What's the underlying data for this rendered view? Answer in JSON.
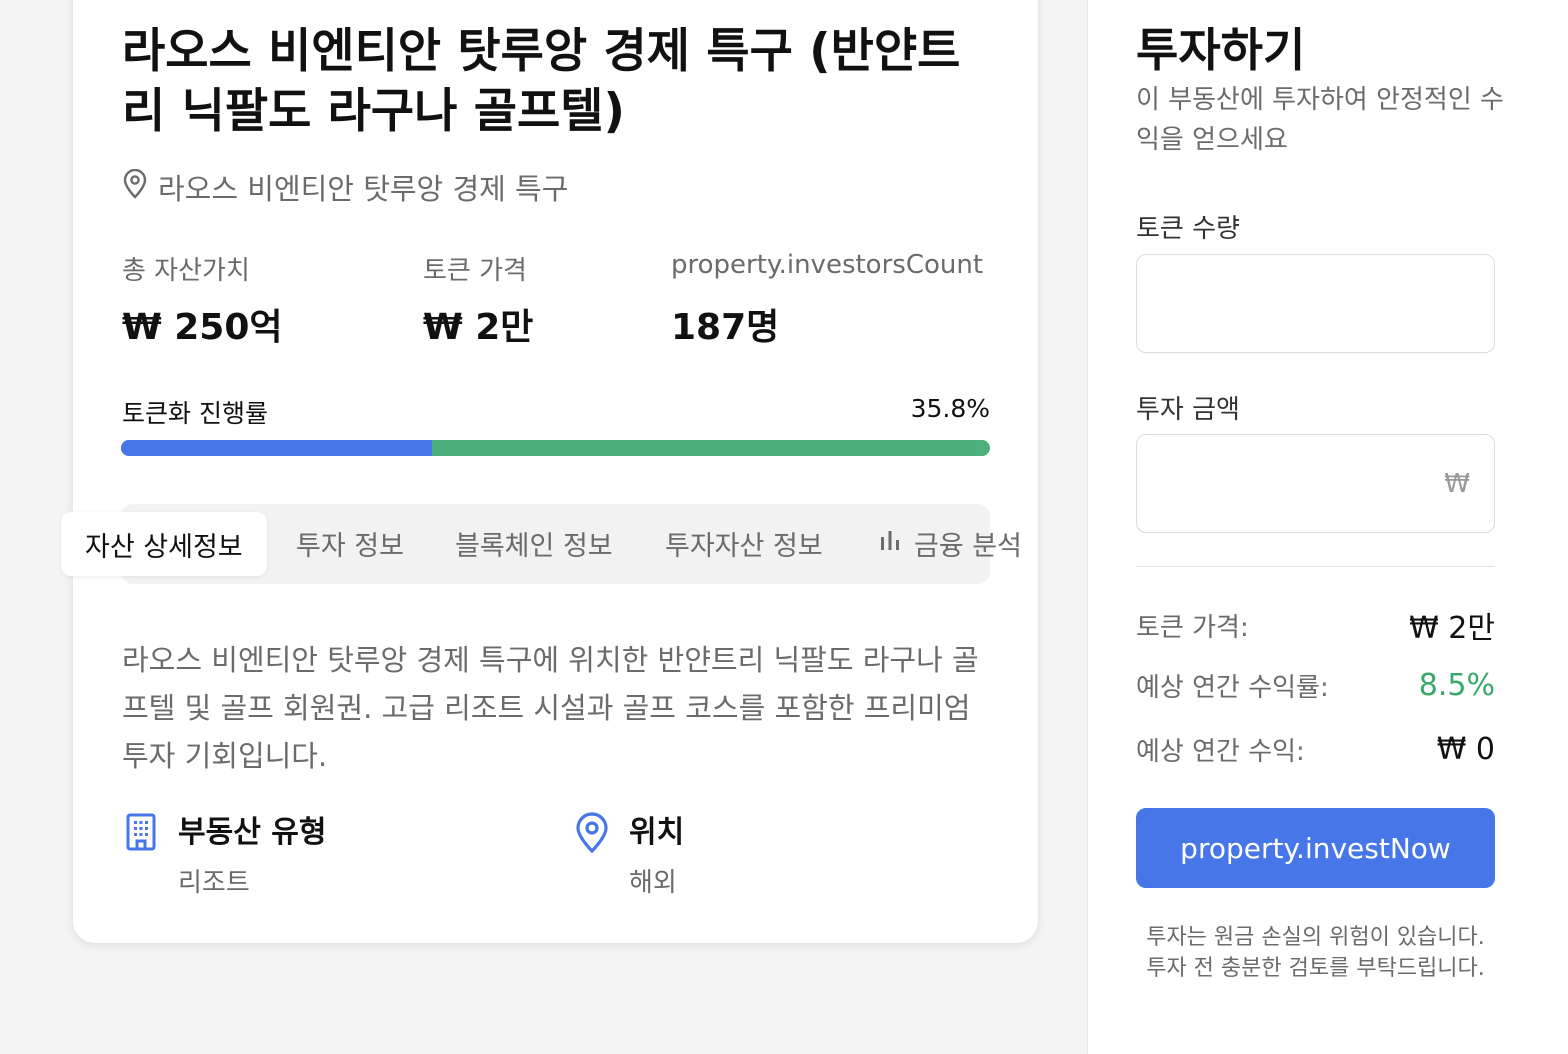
{
  "property": {
    "title": "라오스 비엔티안 탓루앙 경제 특구 (반얀트리 닉팔도 라구나 골프텔)",
    "location": "라오스 비엔티안 탓루앙 경제 특구",
    "stats": [
      {
        "label": "총 자산가치",
        "value": "₩ 250억"
      },
      {
        "label": "토큰 가격",
        "value": "₩ 2만"
      },
      {
        "label": "property.investorsCount",
        "value": "187명"
      }
    ],
    "progress": {
      "label": "토큰화 진행률",
      "value_text": "35.8%",
      "fraction": 0.358
    }
  },
  "tabs": [
    {
      "label": "자산 상세정보",
      "icon": ""
    },
    {
      "label": "투자 정보",
      "icon": ""
    },
    {
      "label": "블록체인 정보",
      "icon": ""
    },
    {
      "label": "투자자산 정보",
      "icon": ""
    },
    {
      "label": "금융 분석",
      "icon": "bar-chart-icon"
    }
  ],
  "description": "라오스 비엔티안 탓루앙 경제 특구에 위치한 반얀트리 닉팔도 라구나 골프텔 및 골프 회원권. 고급 리조트 시설과 골프 코스를 포함한 프리미엄 투자 기회입니다.",
  "info": {
    "type": {
      "label": "부동산 유형",
      "value": "리조트",
      "icon": "building-icon"
    },
    "location": {
      "label": "위치",
      "value": "해외",
      "icon": "map-pin-icon"
    }
  },
  "invest": {
    "title": "투자하기",
    "subtitle": "이 부동산에 투자하여 안정적인 수익을 얻으세요",
    "token_qty_label": "토큰 수량",
    "token_qty_value": "",
    "amount_label": "투자 금액",
    "amount_suffix": "₩",
    "summary": {
      "token_price_label": "토큰 가격:",
      "token_price_value": "₩ 2만",
      "yield_label": "예상 연간 수익률:",
      "yield_value": "8.5%",
      "income_label": "예상 연간 수익:",
      "income_value": "₩ 0"
    },
    "button_label": "property.investNow",
    "disclaimer": "투자는 원금 손실의 위험이 있습니다. 투자 전 충분한 검토를 부탁드립니다."
  },
  "colors": {
    "accent": "#4676e8",
    "green": "#4caf7c",
    "yield": "#3aa86b"
  }
}
